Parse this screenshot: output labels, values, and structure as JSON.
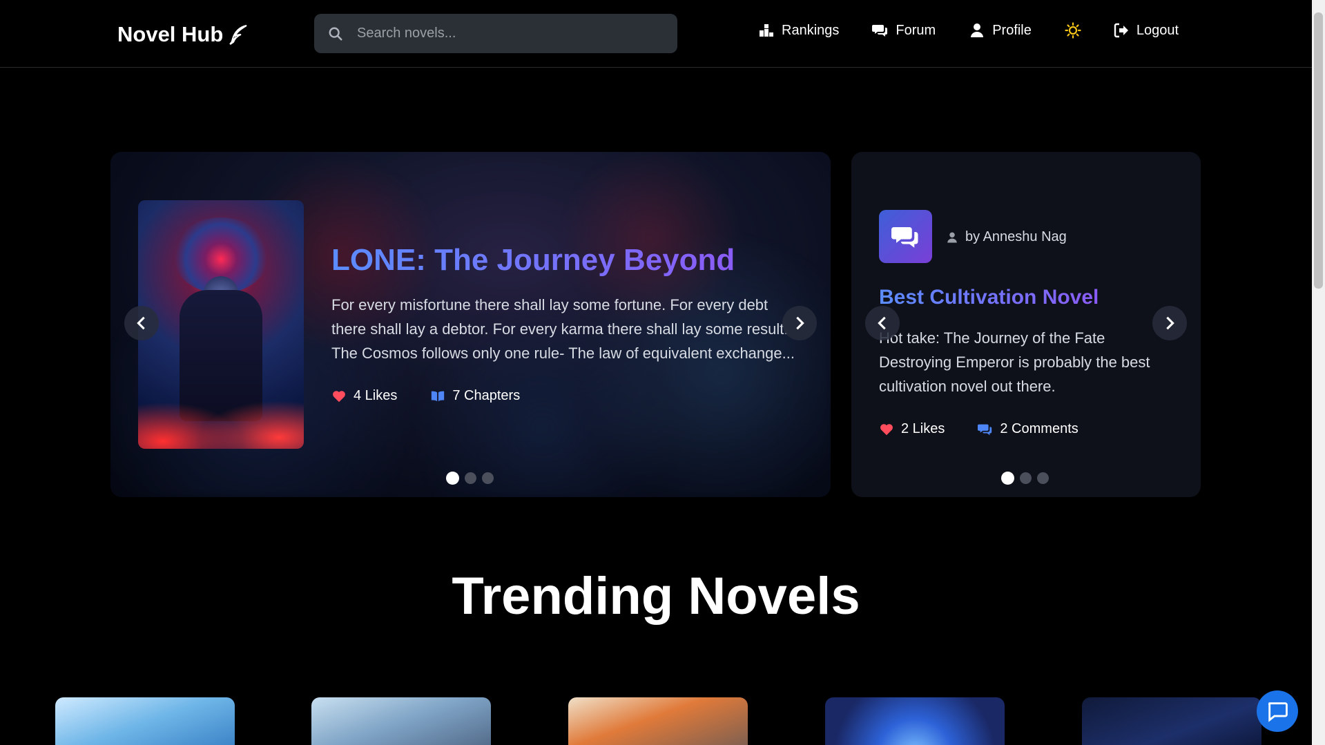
{
  "navbar": {
    "brand": "Novel Hub",
    "search_placeholder": "Search novels...",
    "links": {
      "rankings": "Rankings",
      "forum": "Forum",
      "profile": "Profile",
      "logout": "Logout"
    }
  },
  "hero": {
    "title": "LONE: The Journey Beyond",
    "description": "For every misfortune there shall lay some fortune. For every debt there shall lay a debtor. For every karma there shall lay some result. The Cosmos follows only one rule- The law of equivalent exchange...",
    "likes": "4 Likes",
    "chapters": "7 Chapters",
    "active_slide": 1,
    "slide_count": 3
  },
  "forum_post": {
    "author": "by Anneshu Nag",
    "title": "Best Cultivation Novel",
    "body": "Hot take: The Journey of the Fate Destroying Emperor is probably the best cultivation novel out there.",
    "likes": "2 Likes",
    "comments": "2 Comments",
    "active_slide": 1,
    "slide_count": 3
  },
  "trending": {
    "title": "Trending Novels",
    "visible_cards": 5
  },
  "colors": {
    "accent_start": "#5b8cff",
    "accent_end": "#8a5cf6",
    "like": "#ff4d5e",
    "chapter_icon": "#4f86f7",
    "theme_icon": "#f5c518",
    "chat_button": "#1a73e8"
  }
}
